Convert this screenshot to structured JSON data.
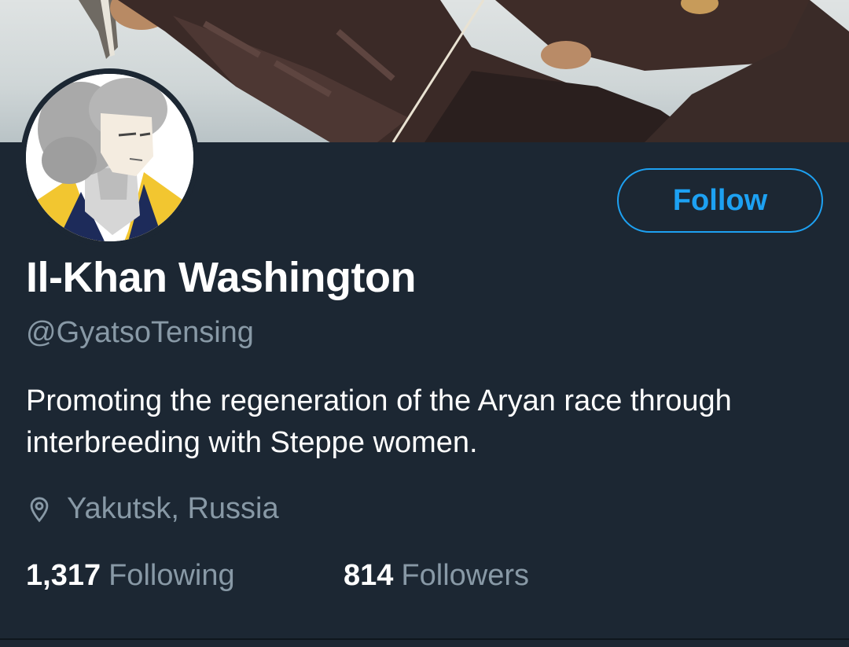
{
  "profile": {
    "name": "Il-Khan Washington",
    "handle": "@GyatsoTensing",
    "bio": "Promoting the regeneration of the Aryan race through interbreeding with Steppe women.",
    "location": "Yakutsk, Russia",
    "following_count": "1,317",
    "following_label": "Following",
    "followers_count": "814",
    "followers_label": "Followers"
  },
  "actions": {
    "follow_label": "Follow"
  },
  "icons": {
    "location": "location-pin-icon"
  },
  "colors": {
    "background": "#1c2733",
    "accent": "#1da1f2",
    "secondary_text": "#8899a6"
  }
}
